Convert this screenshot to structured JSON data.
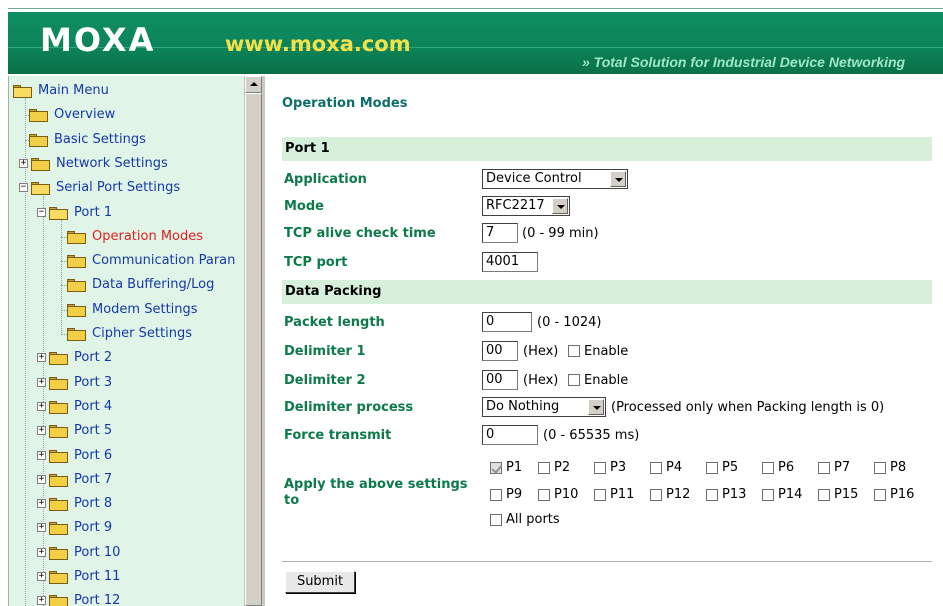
{
  "header": {
    "logo": "MOXA",
    "url": "www.moxa.com",
    "tagline": "» Total Solution for Industrial Device Networking"
  },
  "sidebar": {
    "items": [
      {
        "label": "Main Menu",
        "icon": "folder-open-icon"
      },
      {
        "label": "Overview",
        "icon": "folder-icon"
      },
      {
        "label": "Basic Settings",
        "icon": "folder-icon"
      },
      {
        "label": "Network Settings",
        "icon": "folder-icon",
        "expander": "+"
      },
      {
        "label": "Serial Port Settings",
        "icon": "folder-open-icon",
        "expander": "−"
      },
      {
        "label": "Port 1",
        "icon": "folder-open-icon",
        "expander": "−"
      },
      {
        "label": "Operation Modes",
        "icon": "folder-icon",
        "active": true
      },
      {
        "label": "Communication Paran",
        "icon": "folder-icon"
      },
      {
        "label": "Data Buffering/Log",
        "icon": "folder-icon"
      },
      {
        "label": "Modem Settings",
        "icon": "folder-icon"
      },
      {
        "label": "Cipher Settings",
        "icon": "folder-icon"
      },
      {
        "label": "Port 2",
        "icon": "folder-icon",
        "expander": "+"
      },
      {
        "label": "Port 3",
        "icon": "folder-icon",
        "expander": "+"
      },
      {
        "label": "Port 4",
        "icon": "folder-icon",
        "expander": "+"
      },
      {
        "label": "Port 5",
        "icon": "folder-icon",
        "expander": "+"
      },
      {
        "label": "Port 6",
        "icon": "folder-icon",
        "expander": "+"
      },
      {
        "label": "Port 7",
        "icon": "folder-icon",
        "expander": "+"
      },
      {
        "label": "Port 8",
        "icon": "folder-icon",
        "expander": "+"
      },
      {
        "label": "Port 9",
        "icon": "folder-icon",
        "expander": "+"
      },
      {
        "label": "Port 10",
        "icon": "folder-icon",
        "expander": "+"
      },
      {
        "label": "Port 11",
        "icon": "folder-icon",
        "expander": "+"
      },
      {
        "label": "Port 12",
        "icon": "folder-icon",
        "expander": "+"
      }
    ]
  },
  "main": {
    "title": "Operation Modes",
    "port_section": "Port 1",
    "application_label": "Application",
    "application_value": "Device Control",
    "mode_label": "Mode",
    "mode_value": "RFC2217",
    "tcp_alive_label": "TCP alive check time",
    "tcp_alive_value": "7",
    "tcp_alive_hint": "(0 - 99 min)",
    "tcp_port_label": "TCP port",
    "tcp_port_value": "4001",
    "packing_section": "Data Packing",
    "packet_length_label": "Packet length",
    "packet_length_value": "0",
    "packet_length_hint": "(0 - 1024)",
    "delimiter1_label": "Delimiter 1",
    "delimiter1_value": "00",
    "delimiter2_label": "Delimiter 2",
    "delimiter2_value": "00",
    "hex_hint": "(Hex)",
    "enable_label": "Enable",
    "delimiter_process_label": "Delimiter process",
    "delimiter_process_value": "Do Nothing",
    "delimiter_process_hint": "(Processed only when Packing length is 0)",
    "force_transmit_label": "Force transmit",
    "force_transmit_value": "0",
    "force_transmit_hint": "(0 - 65535 ms)",
    "apply_label_line1": "Apply the above settings",
    "apply_label_line2": "to",
    "ports": [
      {
        "label": "P1",
        "checked": true
      },
      {
        "label": "P2",
        "checked": false
      },
      {
        "label": "P3",
        "checked": false
      },
      {
        "label": "P4",
        "checked": false
      },
      {
        "label": "P5",
        "checked": false
      },
      {
        "label": "P6",
        "checked": false
      },
      {
        "label": "P7",
        "checked": false
      },
      {
        "label": "P8",
        "checked": false
      },
      {
        "label": "P9",
        "checked": false
      },
      {
        "label": "P10",
        "checked": false
      },
      {
        "label": "P11",
        "checked": false
      },
      {
        "label": "P12",
        "checked": false
      },
      {
        "label": "P13",
        "checked": false
      },
      {
        "label": "P14",
        "checked": false
      },
      {
        "label": "P15",
        "checked": false
      },
      {
        "label": "P16",
        "checked": false
      }
    ],
    "all_ports_label": "All ports",
    "submit_label": "Submit"
  }
}
